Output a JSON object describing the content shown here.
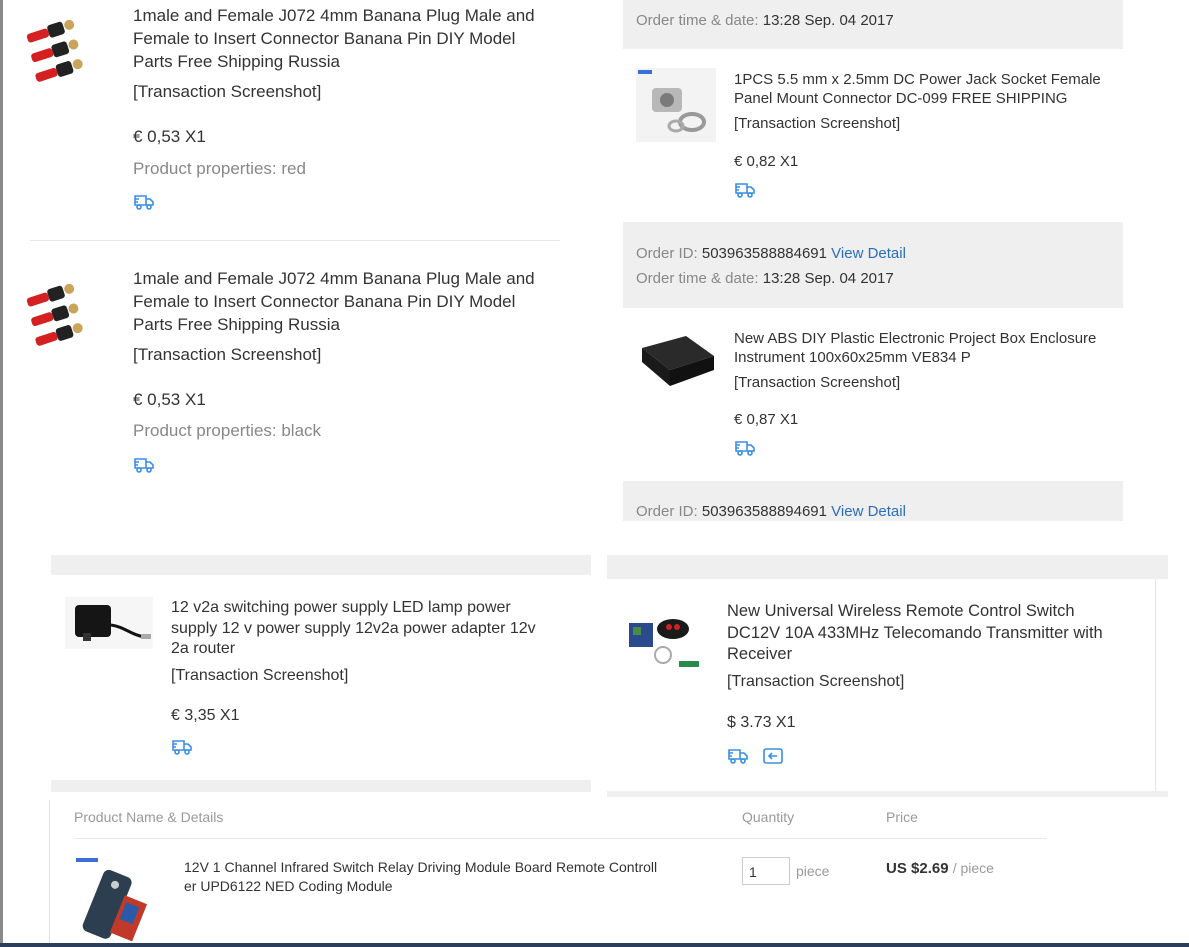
{
  "left_items": [
    {
      "title": "1male and Female J072 4mm Banana Plug Male and Female to Insert Connector Banana Pin DIY Model Parts Free Shipping Russia",
      "title_lines": [
        "1male and Female J072 4mm Banana Plug Male and",
        "Female to Insert Connector Banana Pin DIY Model",
        "Parts Free Shipping Russia"
      ],
      "screenshot_label": "[Transaction Screenshot]",
      "price": "€ 0,53 X1",
      "properties": "Product properties: red",
      "icon": "truck-icon"
    },
    {
      "title_lines": [
        "1male and Female J072 4mm Banana Plug Male and",
        "Female to Insert Connector Banana Pin DIY Model",
        "Parts Free Shipping Russia"
      ],
      "screenshot_label": "[Transaction Screenshot]",
      "price": "€ 0,53 X1",
      "properties": "Product properties: black",
      "icon": "truck-icon"
    }
  ],
  "right_orders": [
    {
      "order_time_label": "Order time & date:",
      "order_time": "13:28 Sep. 04 2017",
      "item": {
        "title_lines": [
          "1PCS 5.5 mm x 2.5mm DC Power Jack Socket Female",
          "Panel Mount Connector DC-099 FREE SHIPPING"
        ],
        "screenshot_label": "[Transaction Screenshot]",
        "price": "€ 0,82 X1"
      }
    },
    {
      "order_id_label": "Order ID:",
      "order_id": "503963588884691",
      "view_detail": "View Detail",
      "order_time_label": "Order time & date:",
      "order_time": "13:28 Sep. 04 2017",
      "item": {
        "title_lines": [
          "New ABS DIY Plastic Electronic Project Box Enclosure",
          "Instrument 100x60x25mm VE834 P"
        ],
        "screenshot_label": "[Transaction Screenshot]",
        "price": "€ 0,87 X1"
      }
    },
    {
      "order_id_label": "Order ID:",
      "order_id": "503963588894691",
      "view_detail": "View Detail"
    }
  ],
  "power_supply": {
    "title_lines": [
      "12 v2a switching power supply LED lamp power",
      "supply 12 v power supply 12v2a power adapter 12v",
      "2a router"
    ],
    "screenshot_label": "[Transaction Screenshot]",
    "price": "€ 3,35 X1"
  },
  "remote_switch": {
    "title_lines": [
      "New Universal Wireless Remote Control Switch",
      "DC12V 10A 433MHz Telecomando Transmitter with",
      "Receiver"
    ],
    "screenshot_label": "[Transaction Screenshot]",
    "price": "$ 3.73 X1"
  },
  "table": {
    "headers": {
      "product": "Product Name & Details",
      "quantity": "Quantity",
      "price": "Price"
    },
    "row": {
      "title_lines": [
        "12V 1 Channel Infrared Switch Relay Driving Module Board Remote Controll",
        "er UPD6122 NED Coding Module"
      ],
      "quantity_value": "1",
      "quantity_unit": "piece",
      "price": "US $2.69",
      "price_unit": "/ piece"
    }
  },
  "colors": {
    "link": "#2a6ebb",
    "icon_blue": "#3a8ee6",
    "grey_panel": "#efefef"
  }
}
